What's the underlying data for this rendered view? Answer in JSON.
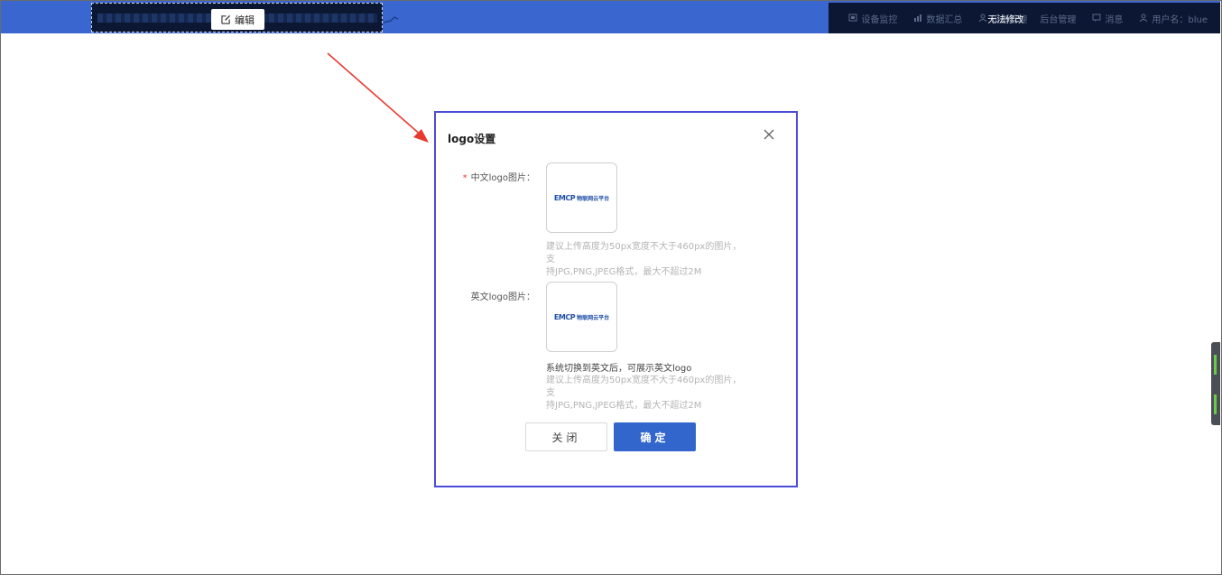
{
  "topbar": {
    "edit_label": "编辑",
    "nav": [
      {
        "icon": "monitor-icon",
        "label": "设备监控"
      },
      {
        "icon": "chart-icon",
        "label": "数据汇总"
      },
      {
        "icon": "user-icon",
        "label": "设备管理",
        "overlay": "无法修改"
      },
      {
        "icon": "none",
        "label": "后台管理"
      },
      {
        "icon": "message-icon",
        "label": "消息"
      },
      {
        "icon": "user-icon",
        "label": "用户名：blue"
      }
    ]
  },
  "modal": {
    "title": "logo设置",
    "cn_logo": {
      "label": "中文logo图片：",
      "required_mark": "*",
      "thumb_brand": "EMCP",
      "thumb_sub": "物联网云平台",
      "hint_line1": "建议上传高度为50px宽度不大于460px的图片，支",
      "hint_line2": "持JPG,PNG,JPEG格式，最大不超过2M"
    },
    "en_logo": {
      "label": "英文logo图片：",
      "thumb_brand": "EMCP",
      "thumb_sub": "物联网云平台",
      "note": "系统切换到英文后，可展示英文logo",
      "hint_line1": "建议上传高度为50px宽度不大于460px的图片，支",
      "hint_line2": "持JPG,PNG,JPEG格式，最大不超过2M"
    },
    "buttons": {
      "close": "关闭",
      "ok": "确定"
    }
  },
  "colors": {
    "topbar": "#3a66cf",
    "dark_overlay": "#0c1833",
    "modal_border": "#4a4dd8",
    "primary": "#3266cc",
    "arrow": "#e8392f",
    "required": "#e23b3b"
  }
}
